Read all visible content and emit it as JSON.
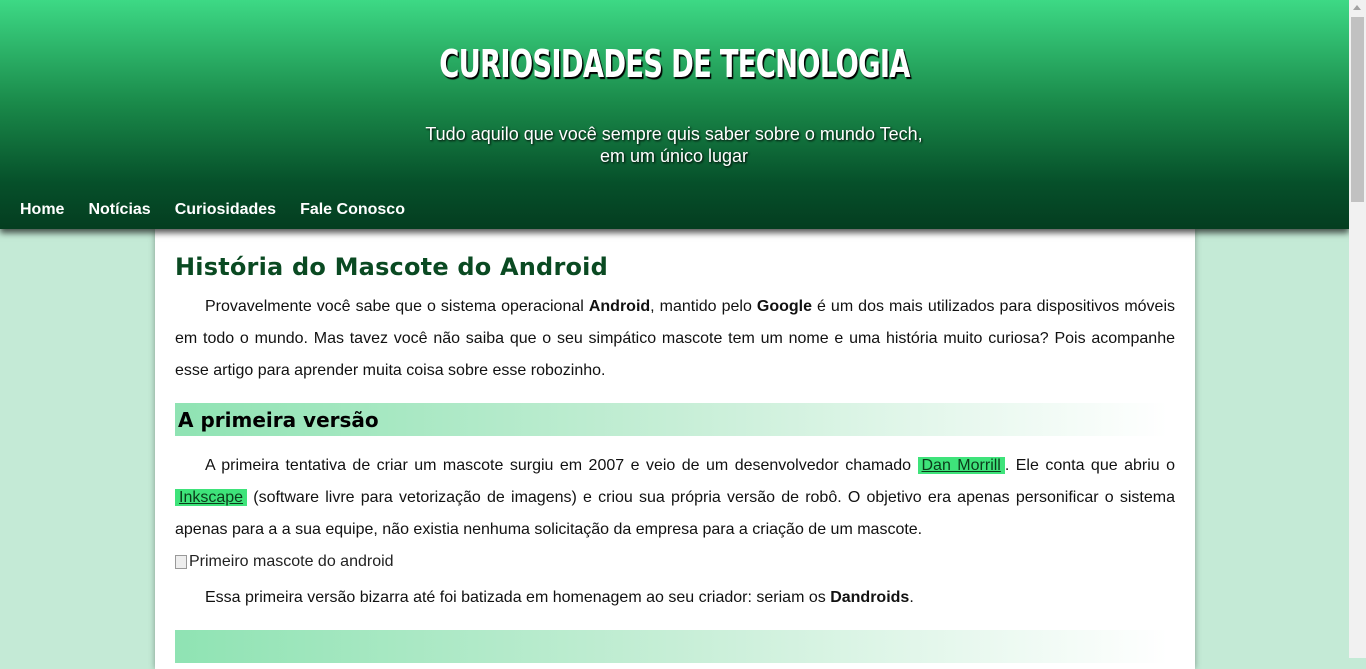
{
  "header": {
    "title": "Curiosidades de Tecnologia",
    "subtitle": "Tudo aquilo que você sempre quis saber sobre o mundo Tech, em um único lugar"
  },
  "nav": {
    "items": [
      {
        "label": "Home"
      },
      {
        "label": "Notícias"
      },
      {
        "label": "Curiosidades"
      },
      {
        "label": "Fale Conosco"
      }
    ]
  },
  "article": {
    "title": "História do Mascote do Android",
    "intro": {
      "t1": "Provavelmente você sabe que o sistema operacional ",
      "b1": "Android",
      "t2": ", mantido pelo ",
      "b2": "Google",
      "t3": " é um dos mais utilizados para dispositivos móveis em todo o mundo. Mas tavez você não saiba que o seu simpático mascote tem um nome e uma história muito curiosa? Pois acompanhe esse artigo para aprender muita coisa sobre esse robozinho."
    },
    "section1": {
      "heading": "A primeira versão",
      "p1": {
        "t1": "A primeira tentativa de criar um mascote surgiu em 2007 e veio de um desenvolvedor chamado ",
        "link1": "Dan Morrill",
        "t2": ". Ele conta que abriu o ",
        "link2": "Inkscape",
        "t3": " (software livre para vetorização de imagens) e criou sua própria versão de robô. O objetivo era apenas personificar o sistema apenas para a a sua equipe, não existia nenhuma solicitação da empresa para a criação de um mascote."
      },
      "image_alt": "Primeiro mascote do android",
      "p2": {
        "t1": "Essa primeira versão bizarra até foi batizada em homenagem ao seu criador: seriam os ",
        "b1": "Dandroids",
        "t2": "."
      }
    }
  },
  "colors": {
    "page_bg": "#c4ead6",
    "header_top": "#3dd985",
    "header_bottom": "#043d20",
    "link_highlight": "#3ee37a",
    "title_color": "#0a4a22"
  }
}
